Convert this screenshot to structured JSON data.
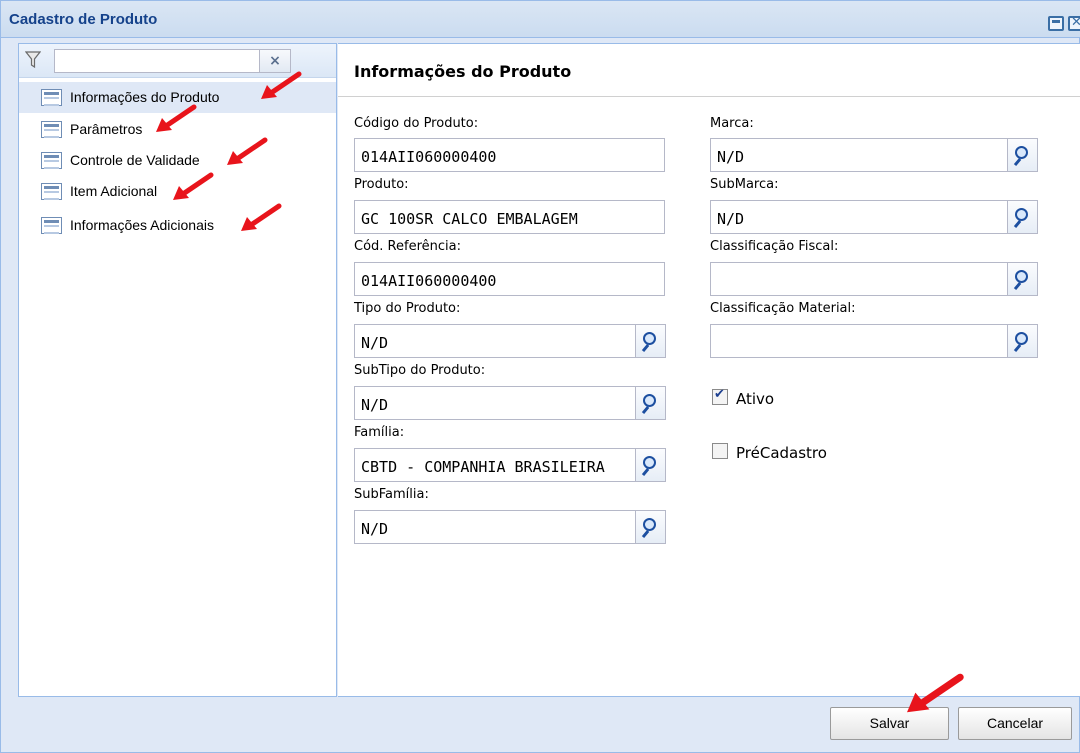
{
  "window": {
    "title": "Cadastro de Produto"
  },
  "tree": {
    "filter_value": "",
    "clear_label": "×",
    "items": [
      {
        "label": "Informações do Produto"
      },
      {
        "label": "Parâmetros"
      },
      {
        "label": "Controle de Validade"
      },
      {
        "label": "Item Adicional"
      },
      {
        "label": "Informações Adicionais"
      }
    ]
  },
  "form": {
    "title": "Informações do Produto",
    "codigo": {
      "label": "Código do Produto:",
      "value": "014AII060000400"
    },
    "produto": {
      "label": "Produto:",
      "value": "GC 100SR CALCO EMBALAGEM"
    },
    "cod_ref": {
      "label": "Cód. Referência:",
      "value": "014AII060000400"
    },
    "tipo": {
      "label": "Tipo do Produto:",
      "value": "N/D"
    },
    "subtipo": {
      "label": "SubTipo do Produto:",
      "value": "N/D"
    },
    "familia": {
      "label": "Família:",
      "value": "CBTD - COMPANHIA BRASILEIRA"
    },
    "subfamilia": {
      "label": "SubFamília:",
      "value": "N/D"
    },
    "marca": {
      "label": "Marca:",
      "value": "N/D"
    },
    "submarca": {
      "label": "SubMarca:",
      "value": "N/D"
    },
    "class_fiscal": {
      "label": "Classificação Fiscal:",
      "value": ""
    },
    "class_material": {
      "label": "Classificação Material:",
      "value": ""
    },
    "ativo": {
      "label": "Ativo",
      "checked": true
    },
    "precadastro": {
      "label": "PréCadastro",
      "checked": false
    }
  },
  "footer": {
    "save_label": "Salvar",
    "cancel_label": "Cancelar"
  },
  "colors": {
    "title_text": "#15428b",
    "panel_bg": "#dfe8f6",
    "border": "#99bbe8",
    "arrow": "#e8141b"
  }
}
